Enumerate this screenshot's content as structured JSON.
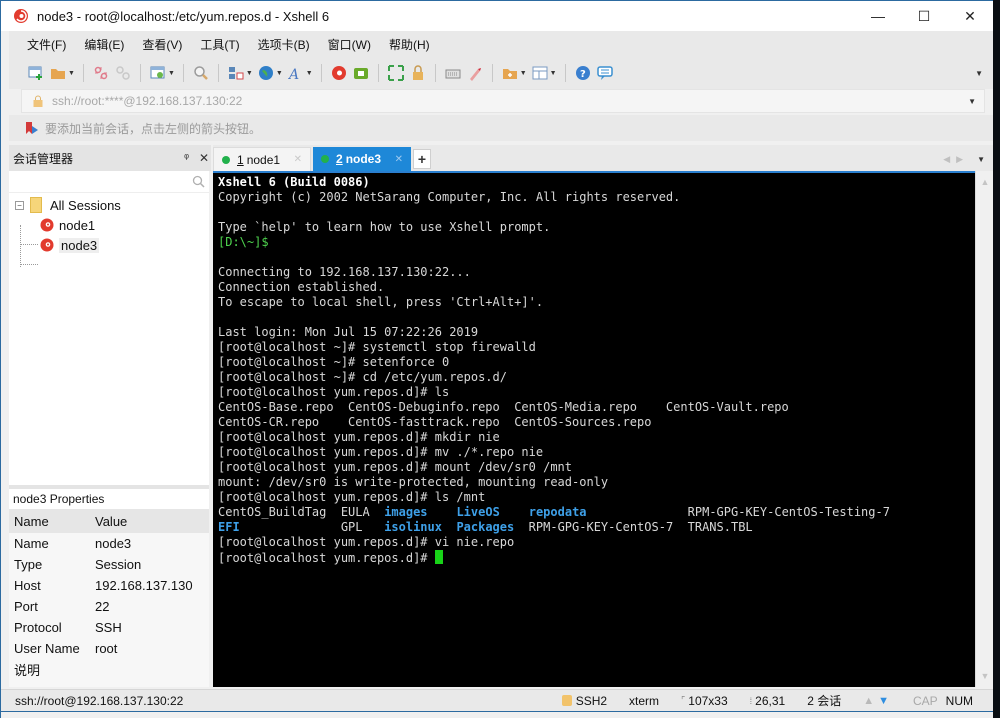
{
  "window": {
    "title": "node3 - root@localhost:/etc/yum.repos.d - Xshell 6",
    "minimize": "—",
    "maximize": "☐",
    "close": "✕"
  },
  "menu": [
    "文件(F)",
    "编辑(E)",
    "查看(V)",
    "工具(T)",
    "选项卡(B)",
    "窗口(W)",
    "帮助(H)"
  ],
  "toolbar": {
    "icons": [
      "new-session-icon",
      "open-folder-icon",
      "disconnect-icon",
      "reconnect-icon",
      "session-properties-icon",
      "find-icon",
      "layout-icon",
      "globe-icon",
      "font-icon",
      "xshell-icon",
      "xftp-icon",
      "fullscreen-icon",
      "lock-icon",
      "keyboard-icon",
      "highlight-icon",
      "new-tab-folder-icon",
      "split-layout-icon",
      "help-icon",
      "chat-icon"
    ]
  },
  "address": {
    "value": "ssh://root:****@192.168.137.130:22"
  },
  "hint": {
    "text": "要添加当前会话，点击左侧的箭头按钮。"
  },
  "session_manager": {
    "title": "会话管理器",
    "pin": "ᵠ",
    "close": "✕",
    "search_placeholder": "",
    "root": "All Sessions",
    "sessions": [
      "node1",
      "node3"
    ],
    "selected": "node3"
  },
  "properties": {
    "title": "node3 Properties",
    "header": {
      "name": "Name",
      "value": "Value"
    },
    "rows": [
      {
        "name": "Name",
        "value": "node3"
      },
      {
        "name": "Type",
        "value": "Session"
      },
      {
        "name": "Host",
        "value": "192.168.137.130"
      },
      {
        "name": "Port",
        "value": "22"
      },
      {
        "name": "Protocol",
        "value": "SSH"
      },
      {
        "name": "User Name",
        "value": "root"
      },
      {
        "name": "说明",
        "value": ""
      }
    ]
  },
  "tabs": [
    {
      "num": "1",
      "label": "node1",
      "active": false,
      "close": "✕"
    },
    {
      "num": "2",
      "label": "node3",
      "active": true,
      "close": "✕"
    }
  ],
  "tab_add": "+",
  "terminal": {
    "lines": [
      "Xshell 6 (Build 0086)",
      "Copyright (c) 2002 NetSarang Computer, Inc. All rights reserved.",
      "",
      "Type `help' to learn how to use Xshell prompt.",
      "[D:\\~]$",
      "",
      "Connecting to 192.168.137.130:22...",
      "Connection established.",
      "To escape to local shell, press 'Ctrl+Alt+]'.",
      "",
      "Last login: Mon Jul 15 07:22:26 2019",
      "[root@localhost ~]# systemctl stop firewalld",
      "[root@localhost ~]# setenforce 0",
      "[root@localhost ~]# cd /etc/yum.repos.d/",
      "[root@localhost yum.repos.d]# ls",
      "CentOS-Base.repo  CentOS-Debuginfo.repo  CentOS-Media.repo    CentOS-Vault.repo",
      "CentOS-CR.repo    CentOS-fasttrack.repo  CentOS-Sources.repo",
      "[root@localhost yum.repos.d]# mkdir nie",
      "[root@localhost yum.repos.d]# mv ./*.repo nie",
      "[root@localhost yum.repos.d]# mount /dev/sr0 /mnt",
      "mount: /dev/sr0 is write-protected, mounting read-only",
      "[root@localhost yum.repos.d]# ls /mnt"
    ],
    "ls_mnt": {
      "row1": [
        {
          "text": "CentOS_BuildTag  ",
          "dir": false
        },
        {
          "text": "EULA  ",
          "dir": false
        },
        {
          "text": "images",
          "dir": true
        },
        {
          "text": "    ",
          "dir": false
        },
        {
          "text": "LiveOS",
          "dir": true
        },
        {
          "text": "    ",
          "dir": false
        },
        {
          "text": "repodata",
          "dir": true
        },
        {
          "text": "              RPM-GPG-KEY-CentOS-Testing-7",
          "dir": false
        }
      ],
      "row2": [
        {
          "text": "EFI",
          "dir": true
        },
        {
          "text": "              GPL   ",
          "dir": false
        },
        {
          "text": "isolinux",
          "dir": true
        },
        {
          "text": "  ",
          "dir": false
        },
        {
          "text": "Packages",
          "dir": true
        },
        {
          "text": "  RPM-GPG-KEY-CentOS-7  TRANS.TBL",
          "dir": false
        }
      ]
    },
    "after": [
      "[root@localhost yum.repos.d]# vi nie.repo"
    ],
    "prompt": "[root@localhost yum.repos.d]# "
  },
  "status": {
    "connection": "ssh://root@192.168.137.130:22",
    "protocol": "SSH2",
    "terminal_type": "xterm",
    "size": "107x33",
    "cursor_pos": "26,31",
    "sessions": "2 会话",
    "cap": "CAP",
    "num": "NUM"
  }
}
